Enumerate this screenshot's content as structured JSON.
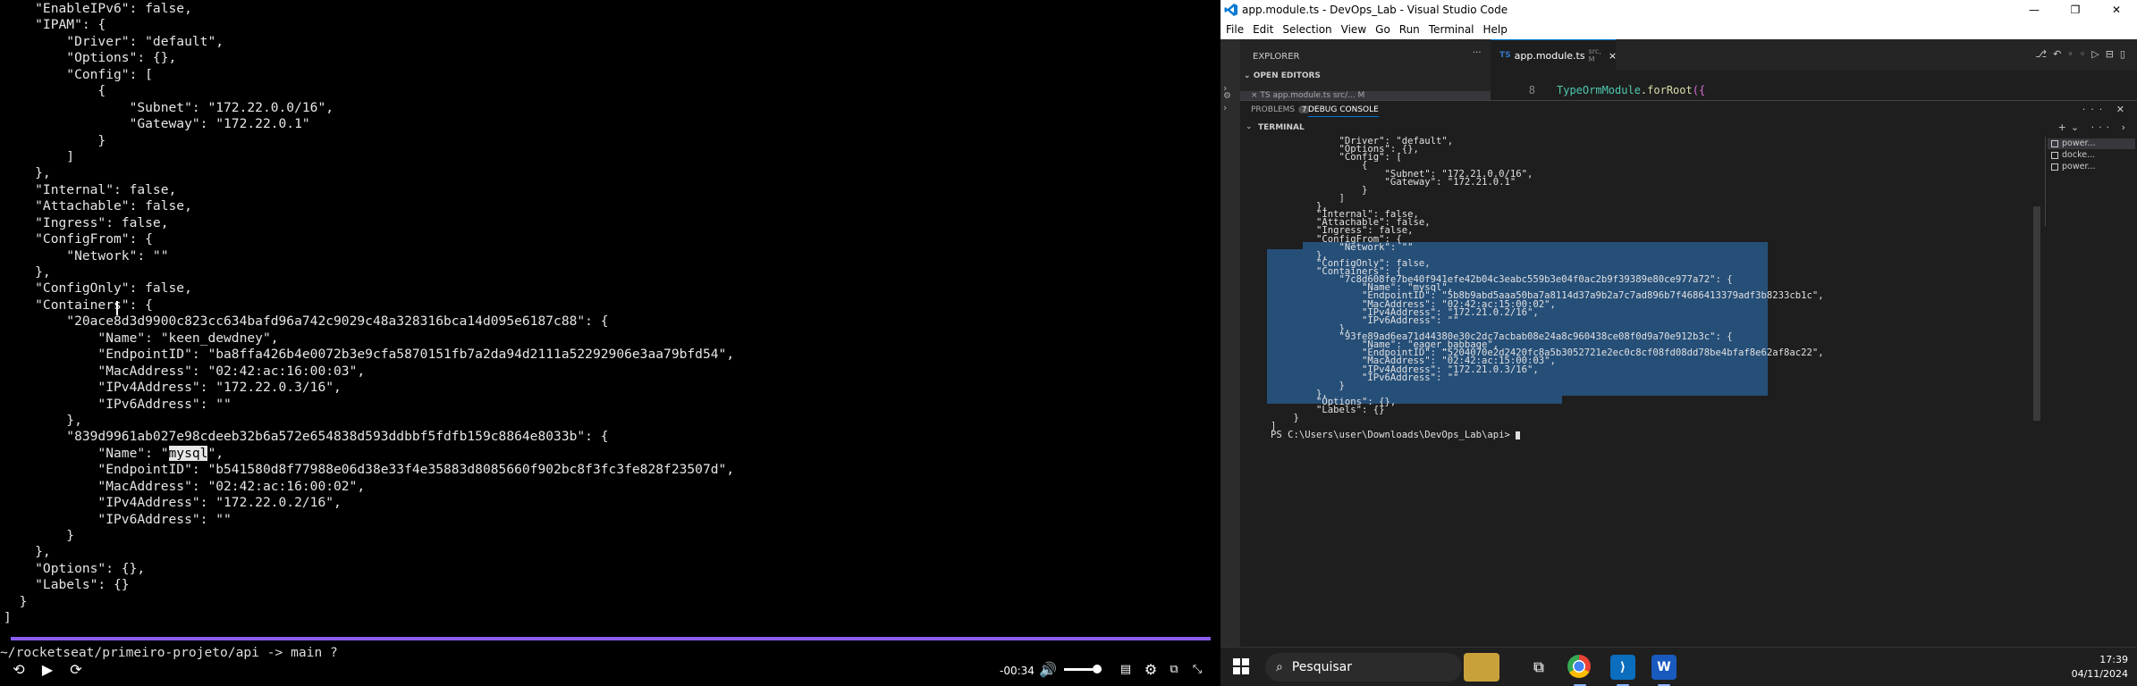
{
  "video": {
    "lines": [
      "    \"EnableIPv6\": false,",
      "    \"IPAM\": {",
      "        \"Driver\": \"default\",",
      "        \"Options\": {},",
      "        \"Config\": [",
      "            {",
      "                \"Subnet\": \"172.22.0.0/16\",",
      "                \"Gateway\": \"172.22.0.1\"",
      "            }",
      "        ]",
      "    },",
      "    \"Internal\": false,",
      "    \"Attachable\": false,",
      "    \"Ingress\": false,",
      "    \"ConfigFrom\": {",
      "        \"Network\": \"\"",
      "    },",
      "    \"ConfigOnly\": false,",
      "    \"Containers\": {",
      "        \"20ace8d3d9900c823cc634bafd96a742c9029c48a328316bca14d095e6187c88\": {",
      "            \"Name\": \"keen_dewdney\",",
      "            \"EndpointID\": \"ba8ffa426b4e0072b3e9cfa5870151fb7a2da94d2111a52292906e3aa79bfd54\",",
      "            \"MacAddress\": \"02:42:ac:16:00:03\",",
      "            \"IPv4Address\": \"172.22.0.3/16\",",
      "            \"IPv6Address\": \"\"",
      "        },",
      "        \"839d9961ab027e98cdeeb32b6a572e654838d593ddbbf5fdfb159c8864e8033b\": {",
      "            \"Name\": \"mysql\",",
      "            \"EndpointID\": \"b541580d8f77988e06d38e33f4e35883d8085660f902bc8f3fc3fe828f23507d\",",
      "            \"MacAddress\": \"02:42:ac:16:00:02\",",
      "            \"IPv4Address\": \"172.22.0.2/16\",",
      "            \"IPv6Address\": \"\"",
      "        }",
      "    },",
      "    \"Options\": {},",
      "    \"Labels\": {}",
      "  }",
      "]"
    ],
    "prompt": "~/rocketseat/primeiro-projeto/api -> main ?",
    "time": "-00:34",
    "progress_fraction": 1.0,
    "volume_fraction": 0.75
  },
  "vscode": {
    "title": "app.module.ts - DevOps_Lab - Visual Studio Code",
    "menu": [
      "File",
      "Edit",
      "Selection",
      "View",
      "Go",
      "Run",
      "Terminal",
      "Help"
    ],
    "explorer_label": "EXPLORER",
    "open_editors_label": "OPEN EDITORS",
    "open_editor_item": "× TS app.module.ts  src/...   M",
    "tab": {
      "lang": "TS",
      "name": "app.module.ts",
      "path": "src, M",
      "modified": "M"
    },
    "code": {
      "line_number": "8",
      "fn": "TypeOrmModule",
      "method": ".forRoot",
      "bracket": "({"
    },
    "panel_tabs": {
      "problems": "PROBLEMS",
      "problems_count": "7",
      "debug": "DEBUG CONSOLE"
    },
    "terminal_label": "TERMINAL",
    "terminal_lines": [
      "            \"Driver\": \"default\",",
      "            \"Options\": {},",
      "            \"Config\": [",
      "                {",
      "                    \"Subnet\": \"172.21.0.0/16\",",
      "                    \"Gateway\": \"172.21.0.1\"",
      "                }",
      "            ]",
      "        },",
      "        \"Internal\": false,",
      "        \"Attachable\": false,",
      "        \"Ingress\": false,",
      "        \"ConfigFrom\": {",
      "            \"Network\": \"\"",
      "        },",
      "        \"ConfigOnly\": false,",
      "        \"Containers\": {",
      "            \"7c8d608fe7be40f941efe42b04c3eabc559b3e04f0ac2b9f39389e80ce977a72\": {",
      "                \"Name\": \"mysql\",",
      "                \"EndpointID\": \"5b8b9abd5aaa50ba7a8114d37a9b2a7c7ad896b7f4686413379adf3b8233cb1c\",",
      "                \"MacAddress\": \"02:42:ac:15:00:02\",",
      "                \"IPv4Address\": \"172.21.0.2/16\",",
      "                \"IPv6Address\": \"\"",
      "            },",
      "            \"93fe89ad6ea71d44380e30c2dc7acbab08e24a8c960438ce08f0d9a70e912b3c\": {",
      "                \"Name\": \"eager_babbage\",",
      "                \"EndpointID\": \"5204070e2d2420fc8a5b3052721e2ec0c8cf08fd08dd78be4bfaf8e62af8ac22\",",
      "                \"MacAddress\": \"02:42:ac:15:00:03\",",
      "                \"IPv4Address\": \"172.21.0.3/16\",",
      "                \"IPv6Address\": \"\"",
      "            }",
      "        },",
      "        \"Options\": {},",
      "        \"Labels\": {}",
      "    }",
      "]",
      "PS C:\\Users\\user\\Downloads\\DevOps_Lab\\api> "
    ],
    "terminal_list": [
      "power...",
      "docke...",
      "power..."
    ]
  },
  "taskbar": {
    "search_label": "Pesquisar",
    "time": "17:39",
    "date": "04/11/2024"
  }
}
